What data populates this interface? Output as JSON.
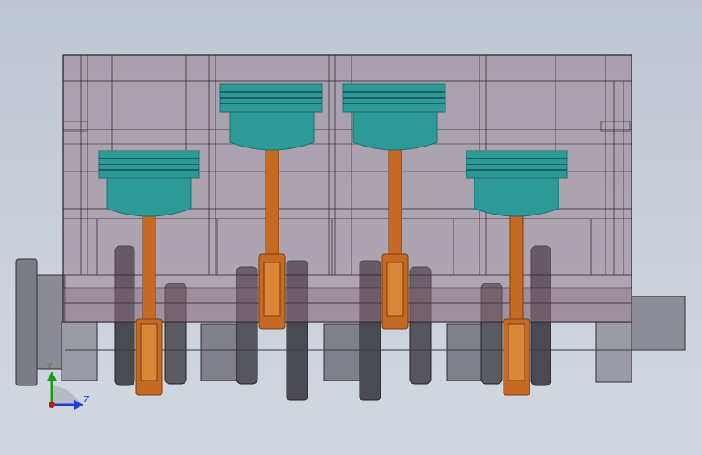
{
  "viewport": {
    "background_top": "#bfc7d3",
    "background_bottom": "#d3d8e0"
  },
  "colors": {
    "block_fill": "#8c6e7e",
    "block_line": "#2a1e28",
    "piston": "#2d9a98",
    "piston_dark": "#1f6f70",
    "rod": "#c46a24",
    "rod_dark": "#7a3c10",
    "crank": "#6e6e74",
    "crank_dark": "#3e3e44",
    "crank_light": "#a9a9b2"
  },
  "pistons": [
    {
      "id": 1,
      "position": "down"
    },
    {
      "id": 2,
      "position": "up"
    },
    {
      "id": 3,
      "position": "up"
    },
    {
      "id": 4,
      "position": "down"
    }
  ],
  "triad": {
    "y_label": "Y",
    "z_label": "Z",
    "y_color": "#14a014",
    "z_color": "#1e3fd6",
    "x_color": "#c01818"
  }
}
